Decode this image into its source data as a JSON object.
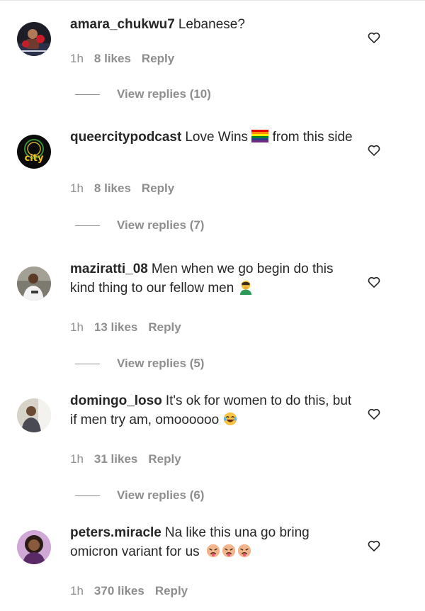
{
  "comments": [
    {
      "username": "amara_chukwu7",
      "text": "Lebanese?",
      "time": "1h",
      "likes": "8 likes",
      "reply_label": "Reply",
      "view_replies": "View replies (10)",
      "avatar_icon": "profile-photo-boxer"
    },
    {
      "username": "queercitypodcast",
      "text_a": "Love Wins",
      "text_b": "from this side",
      "time": "1h",
      "likes": "8 likes",
      "reply_label": "Reply",
      "view_replies": "View replies (7)",
      "avatar_icon": "queer-city-logo",
      "avatar_text": "city",
      "emoji_icon": "rainbow-flag-icon"
    },
    {
      "username": "maziratti_08",
      "text": "Men when we go begin do this kind thing to our fellow men",
      "time": "1h",
      "likes": "13 likes",
      "reply_label": "Reply",
      "view_replies": "View replies (5)",
      "avatar_icon": "profile-photo-man",
      "emoji_icon": "facepalm-emoji-icon"
    },
    {
      "username": "domingo_loso",
      "text": "It's ok for women to do this, but if men try am, omoooooo",
      "time": "1h",
      "likes": "31 likes",
      "reply_label": "Reply",
      "view_replies": "View replies (6)",
      "avatar_icon": "profile-photo-man",
      "emoji_icon": "laughing-emoji-icon"
    },
    {
      "username": "peters.miracle",
      "text": "Na like this una go bring omicron variant for us",
      "time": "1h",
      "likes": "370 likes",
      "reply_label": "Reply",
      "avatar_icon": "profile-photo-woman",
      "emoji_icon": "nauseated-emoji-icon"
    }
  ],
  "colors": {
    "text": "#262626",
    "meta": "#8e8e8e",
    "divider": "#e6e6e6"
  }
}
